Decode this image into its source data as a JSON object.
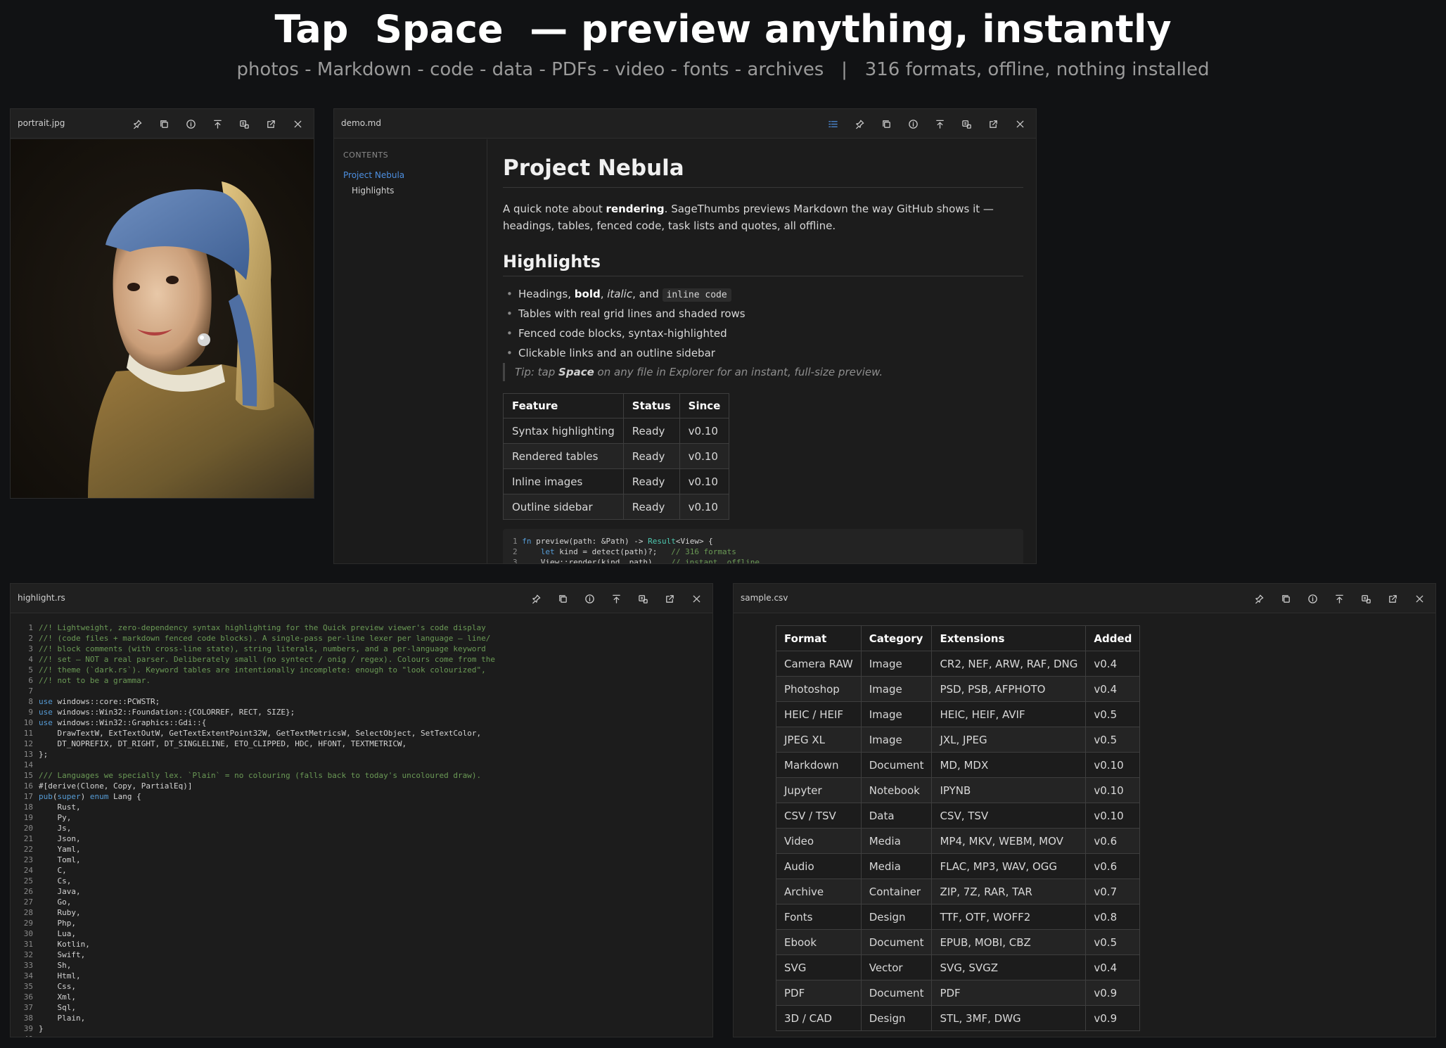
{
  "hero": {
    "title": "Tap  Space  — preview anything, instantly",
    "subtitle": "photos - Markdown - code - data - PDFs - video - fonts - archives   |   316 formats, offline, nothing installed"
  },
  "colors": {
    "background": "#111214",
    "panel": "#1c1c1c",
    "accent": "#4d8fe0",
    "comment": "#6a9955",
    "keyword": "#569cd6",
    "type": "#4ec9b0"
  },
  "titlebar_icons": [
    "pin-icon",
    "copy-icon",
    "info-icon",
    "export-icon",
    "open-with-icon",
    "external-link-icon",
    "close-icon"
  ],
  "windows": {
    "portrait": {
      "filename": "portrait.jpg"
    },
    "markdown": {
      "filename": "demo.md",
      "toc": {
        "heading": "CONTENTS",
        "items": [
          "Project Nebula",
          "Highlights"
        ]
      },
      "h1": "Project Nebula",
      "intro": {
        "p1": "A quick note about ",
        "b1": "rendering",
        "p2": ". SageThumbs previews Markdown the way GitHub shows it — headings, tables, fenced code, task lists and quotes, all offline."
      },
      "h2": "Highlights",
      "list": {
        "item1": {
          "a": "Headings, ",
          "b": "bold",
          "c": ", ",
          "i": "italic",
          "d": ", and ",
          "code": "inline code"
        },
        "item2": "Tables with real grid lines and shaded rows",
        "item3": "Fenced code blocks, syntax-highlighted",
        "item4": "Clickable links and an outline sidebar"
      },
      "quote": {
        "a": "Tip: tap ",
        "b": "Space",
        "c": " on any file in Explorer for an instant, full-size preview."
      },
      "table": {
        "headers": [
          "Feature",
          "Status",
          "Since"
        ],
        "rows": [
          [
            "Syntax highlighting",
            "Ready",
            "v0.10"
          ],
          [
            "Rendered tables",
            "Ready",
            "v0.10"
          ],
          [
            "Inline images",
            "Ready",
            "v0.10"
          ],
          [
            "Outline sidebar",
            "Ready",
            "v0.10"
          ]
        ]
      },
      "code": [
        [
          [
            "1",
            "ln"
          ],
          [
            "fn",
            "k"
          ],
          [
            " preview(path: &Path) -> ",
            "tx"
          ],
          [
            "Result",
            "t"
          ],
          [
            "<View> {",
            "tx"
          ]
        ],
        [
          [
            "2",
            "ln"
          ],
          [
            "    ",
            "tx"
          ],
          [
            "let",
            "k"
          ],
          [
            " kind = detect(path)?;   ",
            "tx"
          ],
          [
            "// 316 formats",
            "c"
          ]
        ],
        [
          [
            "3",
            "ln"
          ],
          [
            "    View::render(kind, path)    ",
            "tx"
          ],
          [
            "// instant, offline",
            "c"
          ]
        ]
      ]
    },
    "code": {
      "filename": "highlight.rs",
      "lines": [
        [
          [
            "//! Lightweight, zero-dependency syntax highlighting for the Quick preview viewer's code display",
            "c"
          ]
        ],
        [
          [
            "//! (code files + markdown fenced code blocks). A single-pass per-line lexer per language — line/",
            "c"
          ]
        ],
        [
          [
            "//! block comments (with cross-line state), string literals, numbers, and a per-language keyword",
            "c"
          ]
        ],
        [
          [
            "//! set — NOT a real parser. Deliberately small (no syntect / onig / regex). Colours come from the",
            "c"
          ]
        ],
        [
          [
            "//! theme (`dark.rs`). Keyword tables are intentionally incomplete: enough to \"look colourized\",",
            "c"
          ]
        ],
        [
          [
            "//! not to be a grammar.",
            "c"
          ]
        ],
        [],
        [
          [
            "use",
            "k"
          ],
          [
            " windows::core::PCWSTR;",
            "tx"
          ]
        ],
        [
          [
            "use",
            "k"
          ],
          [
            " windows::Win32::Foundation::{COLORREF, RECT, SIZE};",
            "tx"
          ]
        ],
        [
          [
            "use",
            "k"
          ],
          [
            " windows::Win32::Graphics::Gdi::{",
            "tx"
          ]
        ],
        [
          [
            "    DrawTextW, ExtTextOutW, GetTextExtentPoint32W, GetTextMetricsW, SelectObject, SetTextColor,",
            "tx"
          ]
        ],
        [
          [
            "    DT_NOPREFIX, DT_RIGHT, DT_SINGLELINE, ETO_CLIPPED, HDC, HFONT, TEXTMETRICW,",
            "tx"
          ]
        ],
        [
          [
            "};",
            "tx"
          ]
        ],
        [],
        [
          [
            "/// Languages we specially lex. `Plain` = no colouring (falls back to today's uncoloured draw).",
            "c"
          ]
        ],
        [
          [
            "#[derive(Clone, Copy, PartialEq)]",
            "tx"
          ]
        ],
        [
          [
            "pub",
            "k"
          ],
          [
            "(",
            "tx"
          ],
          [
            "super",
            "k"
          ],
          [
            ") ",
            "tx"
          ],
          [
            "enum",
            "k"
          ],
          [
            " Lang {",
            "tx"
          ]
        ],
        [
          [
            "    Rust,",
            "tx"
          ]
        ],
        [
          [
            "    Py,",
            "tx"
          ]
        ],
        [
          [
            "    Js,",
            "tx"
          ]
        ],
        [
          [
            "    Json,",
            "tx"
          ]
        ],
        [
          [
            "    Yaml,",
            "tx"
          ]
        ],
        [
          [
            "    Toml,",
            "tx"
          ]
        ],
        [
          [
            "    C,",
            "tx"
          ]
        ],
        [
          [
            "    Cs,",
            "tx"
          ]
        ],
        [
          [
            "    Java,",
            "tx"
          ]
        ],
        [
          [
            "    Go,",
            "tx"
          ]
        ],
        [
          [
            "    Ruby,",
            "tx"
          ]
        ],
        [
          [
            "    Php,",
            "tx"
          ]
        ],
        [
          [
            "    Lua,",
            "tx"
          ]
        ],
        [
          [
            "    Kotlin,",
            "tx"
          ]
        ],
        [
          [
            "    Swift,",
            "tx"
          ]
        ],
        [
          [
            "    Sh,",
            "tx"
          ]
        ],
        [
          [
            "    Html,",
            "tx"
          ]
        ],
        [
          [
            "    Css,",
            "tx"
          ]
        ],
        [
          [
            "    Xml,",
            "tx"
          ]
        ],
        [
          [
            "    Sql,",
            "tx"
          ]
        ],
        [
          [
            "    Plain,",
            "tx"
          ]
        ],
        [
          [
            "}",
            "tx"
          ]
        ],
        []
      ]
    },
    "csv": {
      "filename": "sample.csv",
      "headers": [
        "Format",
        "Category",
        "Extensions",
        "Added"
      ],
      "rows": [
        [
          "Camera RAW",
          "Image",
          "CR2, NEF, ARW, RAF, DNG",
          "v0.4"
        ],
        [
          "Photoshop",
          "Image",
          "PSD, PSB, AFPHOTO",
          "v0.4"
        ],
        [
          "HEIC / HEIF",
          "Image",
          "HEIC, HEIF, AVIF",
          "v0.5"
        ],
        [
          "JPEG XL",
          "Image",
          "JXL, JPEG",
          "v0.5"
        ],
        [
          "Markdown",
          "Document",
          "MD, MDX",
          "v0.10"
        ],
        [
          "Jupyter",
          "Notebook",
          "IPYNB",
          "v0.10"
        ],
        [
          "CSV / TSV",
          "Data",
          "CSV, TSV",
          "v0.10"
        ],
        [
          "Video",
          "Media",
          "MP4, MKV, WEBM, MOV",
          "v0.6"
        ],
        [
          "Audio",
          "Media",
          "FLAC, MP3, WAV, OGG",
          "v0.6"
        ],
        [
          "Archive",
          "Container",
          "ZIP, 7Z, RAR, TAR",
          "v0.7"
        ],
        [
          "Fonts",
          "Design",
          "TTF, OTF, WOFF2",
          "v0.8"
        ],
        [
          "Ebook",
          "Document",
          "EPUB, MOBI, CBZ",
          "v0.5"
        ],
        [
          "SVG",
          "Vector",
          "SVG, SVGZ",
          "v0.4"
        ],
        [
          "PDF",
          "Document",
          "PDF",
          "v0.9"
        ],
        [
          "3D / CAD",
          "Design",
          "STL, 3MF, DWG",
          "v0.9"
        ]
      ]
    }
  }
}
